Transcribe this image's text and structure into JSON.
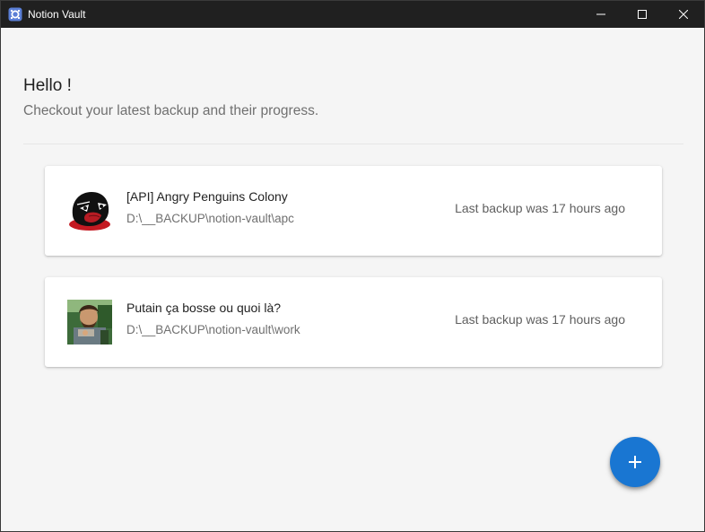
{
  "window": {
    "title": "Notion Vault",
    "icon": "notion-vault-logo-icon",
    "controls": [
      "minimize-icon",
      "maximize-icon",
      "close-icon"
    ]
  },
  "header": {
    "greeting": "Hello !",
    "subtitle": "Checkout your latest backup and their progress."
  },
  "backups": [
    {
      "name": "[API] Angry Penguins Colony",
      "path": "D:\\__BACKUP\\notion-vault\\apc",
      "status": "Last backup was 17 hours ago",
      "avatar": "angry-penguin-logo"
    },
    {
      "name": "Putain ça bosse ou quoi là?",
      "path": "D:\\__BACKUP\\notion-vault\\work",
      "status": "Last backup was 17 hours ago",
      "avatar": "person-photo"
    }
  ],
  "fab": {
    "icon": "plus-icon"
  },
  "colors": {
    "titlebar": "#202020",
    "accent": "#1976d2",
    "background": "#f5f5f5"
  }
}
